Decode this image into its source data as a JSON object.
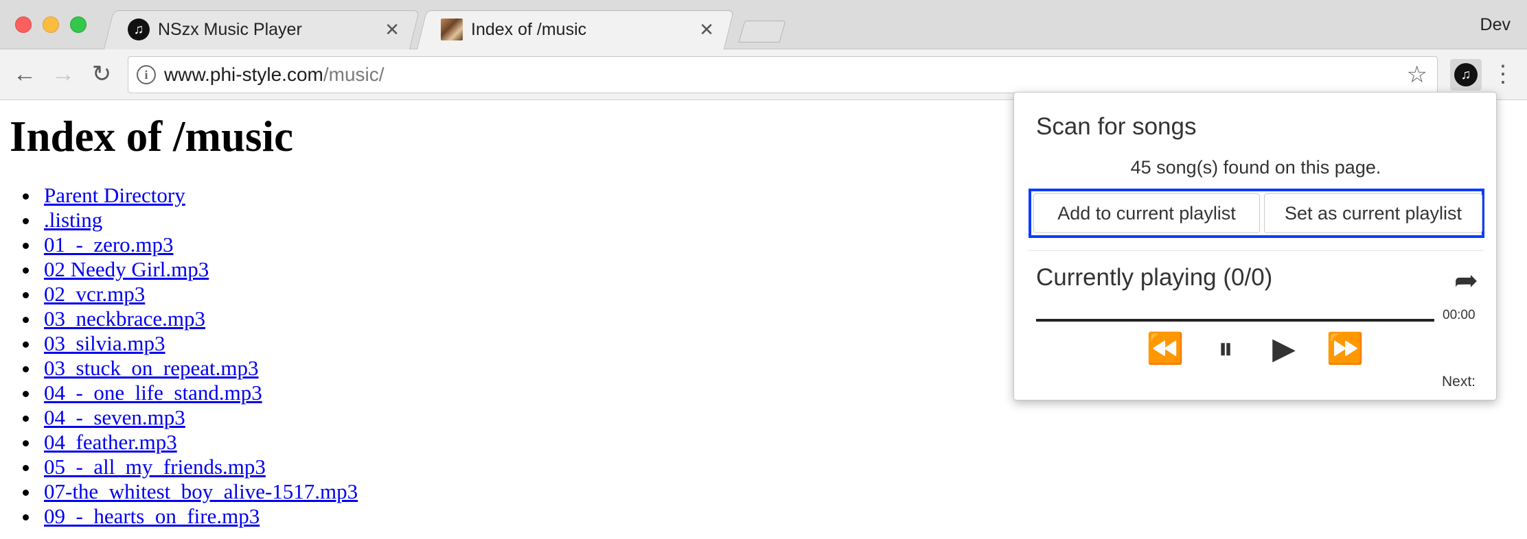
{
  "browser": {
    "tabs": [
      {
        "title": "NSzx Music Player",
        "favicon": "music-note-icon",
        "active": false
      },
      {
        "title": "Index of /music",
        "favicon": "image-favicon",
        "active": true
      }
    ],
    "profile": "Dev",
    "address": {
      "host": "www.phi-style.com",
      "path": "/music/"
    }
  },
  "page": {
    "heading": "Index of /music",
    "links": [
      "Parent Directory",
      ".listing",
      "01_-_zero.mp3",
      "02 Needy Girl.mp3",
      "02_vcr.mp3",
      "03_neckbrace.mp3",
      "03_silvia.mp3",
      "03_stuck_on_repeat.mp3",
      "04_-_one_life_stand.mp3",
      "04_-_seven.mp3",
      "04_feather.mp3",
      "05_-_all_my_friends.mp3",
      "07-the_whitest_boy_alive-1517.mp3",
      "09_-_hearts_on_fire.mp3"
    ]
  },
  "popup": {
    "scan_title": "Scan for songs",
    "found_text": "45 song(s) found on this page.",
    "add_button": "Add to current playlist",
    "set_button": "Set as current playlist",
    "now_playing_title": "Currently playing (0/0)",
    "time": "00:00",
    "progress": 0,
    "next_label": "Next:",
    "highlight_color": "#0a3cff"
  }
}
